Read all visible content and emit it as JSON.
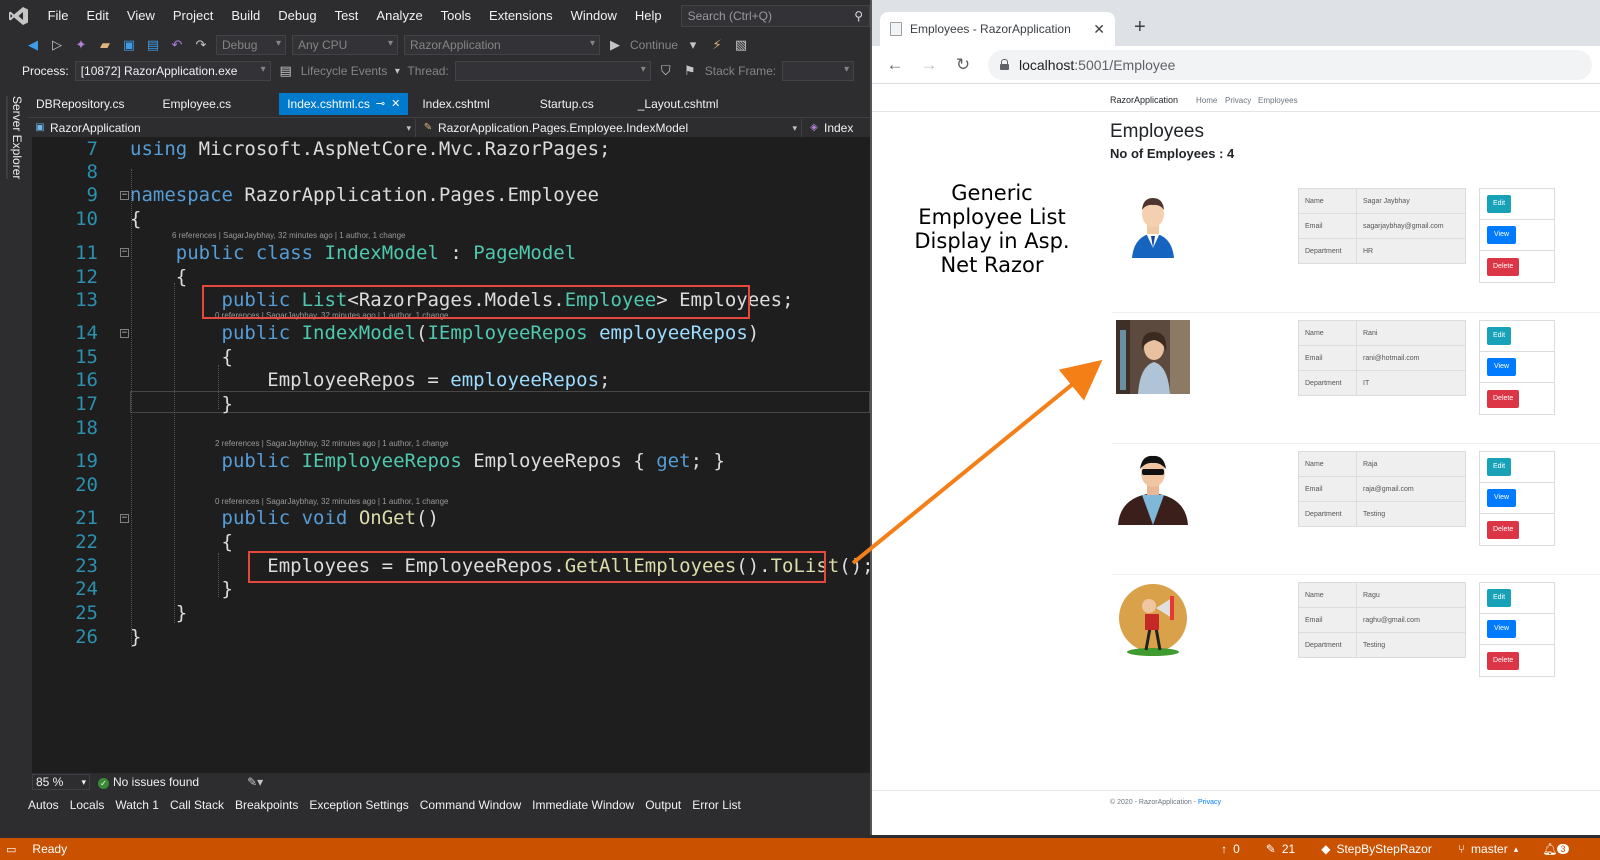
{
  "vs": {
    "menu": [
      "File",
      "Edit",
      "View",
      "Project",
      "Build",
      "Debug",
      "Test",
      "Analyze",
      "Tools",
      "Extensions",
      "Window",
      "Help"
    ],
    "search_placeholder": "Search (Ctrl+Q)",
    "toolbar": {
      "config": "Debug",
      "platform": "Any CPU",
      "startup_project": "RazorApplication",
      "continue_label": "Continue"
    },
    "debug_toolbar": {
      "process_label": "Process:",
      "process_value": "[10872] RazorApplication.exe",
      "lifecycle_label": "Lifecycle Events",
      "thread_label": "Thread:",
      "stack_frame_label": "Stack Frame:"
    },
    "side_tab": "Server Explorer",
    "doc_tabs": [
      "DBRepository.cs",
      "Employee.cs",
      "Index.cshtml.cs",
      "Index.cshtml",
      "Startup.cs",
      "_Layout.cshtml"
    ],
    "active_tab": "Index.cshtml.cs",
    "nav": {
      "project": "RazorApplication",
      "class": "RazorApplication.Pages.Employee.IndexModel",
      "member": "Index"
    },
    "code_lens": {
      "l11": "6 references | SagarJaybhay, 32 minutes ago | 1 author, 1 change",
      "l14": "0 references | SagarJaybhay, 32 minutes ago | 1 author, 1 change",
      "l19": "2 references | SagarJaybhay, 32 minutes ago | 1 author, 1 change",
      "l21": "0 references | SagarJaybhay, 32 minutes ago | 1 author, 1 change"
    },
    "status": {
      "zoom": "85 %",
      "issues": "No issues found"
    },
    "tool_tabs": [
      "Autos",
      "Locals",
      "Watch 1",
      "Call Stack",
      "Breakpoints",
      "Exception Settings",
      "Command Window",
      "Immediate Window",
      "Output",
      "Error List"
    ],
    "statusbar": {
      "ready": "Ready",
      "up_count": "0",
      "edit_count": "21",
      "repo": "StepByStepRazor",
      "branch": "master",
      "notifications": "3"
    }
  },
  "browser": {
    "tab_title": "Employees - RazorApplication",
    "url_host": "localhost",
    "url_path": ":5001/Employee",
    "site": {
      "brand": "RazorApplication",
      "links": [
        "Home",
        "Privacy",
        "Employees"
      ],
      "heading": "Employees",
      "count_text": "No of Employees : 4",
      "footer_text": "© 2020 - RazorApplication - ",
      "footer_link": "Privacy"
    },
    "field_labels": [
      "Name",
      "Email",
      "Department"
    ],
    "buttons": [
      "Edit",
      "View",
      "Delete"
    ],
    "employees": [
      {
        "name": "Sagar Jaybhay",
        "email": "sagarjaybhay@gmail.com",
        "department": "HR"
      },
      {
        "name": "Rani",
        "email": "rani@hotmail.com",
        "department": "IT"
      },
      {
        "name": "Raja",
        "email": "raja@gmail.com",
        "department": "Testing"
      },
      {
        "name": "Ragu",
        "email": "raghu@gmail.com",
        "department": "Testing"
      }
    ]
  },
  "overlay_caption": [
    "Generic",
    "Employee List",
    "Display in Asp.",
    "Net Razor"
  ],
  "colors": {
    "vs_accent": "#007acc",
    "statusbar": "#ca5100",
    "highlight_box": "#e5483d",
    "arrow": "#f57f17"
  }
}
